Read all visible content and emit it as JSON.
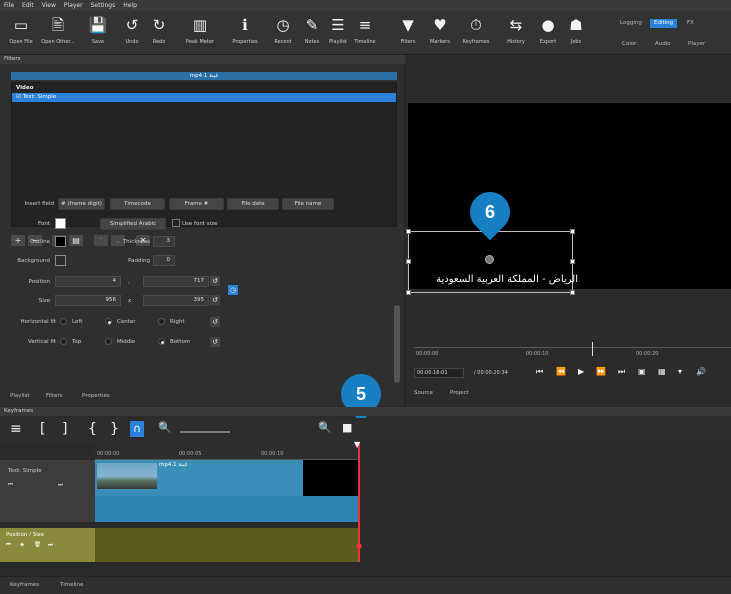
{
  "menu": [
    "File",
    "Edit",
    "View",
    "Player",
    "Settings",
    "Help"
  ],
  "toolbar": [
    {
      "icon": "folder-icon",
      "glyph": "▭",
      "label": "Open File"
    },
    {
      "icon": "open-other-icon",
      "glyph": "🖹",
      "label": "Open Other..."
    },
    {
      "icon": "save-icon",
      "glyph": "💾",
      "label": "Save"
    },
    {
      "icon": "undo-icon",
      "glyph": "↺",
      "label": "Undo"
    },
    {
      "icon": "redo-icon",
      "glyph": "↻",
      "label": "Redo"
    },
    {
      "icon": "peak-meter-icon",
      "glyph": "▥",
      "label": "Peak Meter"
    },
    {
      "icon": "properties-icon",
      "glyph": "ℹ",
      "label": "Properties"
    },
    {
      "icon": "recent-icon",
      "glyph": "◷",
      "label": "Recent"
    },
    {
      "icon": "notes-icon",
      "glyph": "✎",
      "label": "Notes"
    },
    {
      "icon": "playlist-icon",
      "glyph": "☰",
      "label": "Playlist"
    },
    {
      "icon": "timeline-icon",
      "glyph": "≡",
      "label": "Timeline"
    },
    {
      "icon": "filters-icon",
      "glyph": "▼",
      "label": "Filters"
    },
    {
      "icon": "markers-icon",
      "glyph": "♥",
      "label": "Markers"
    },
    {
      "icon": "keyframes-icon",
      "glyph": "⏱",
      "label": "Keyframes"
    },
    {
      "icon": "history-icon",
      "glyph": "⇆",
      "label": "History"
    },
    {
      "icon": "export-icon",
      "glyph": "●",
      "label": "Export"
    },
    {
      "icon": "jobs-icon",
      "glyph": "☗",
      "label": "Jobs"
    }
  ],
  "layouts": {
    "tabs": [
      "Logging",
      "Editing",
      "FX"
    ],
    "active": "Editing",
    "sub": [
      "Color",
      "Audio",
      "Player"
    ]
  },
  "filters": {
    "panel_title": "Filters",
    "clip_name": "mp4.1 غينة",
    "list_header": "Video",
    "filter_item": "Text: Simple",
    "insert_field_label": "Insert field",
    "insert_buttons": [
      "# (frame digit)",
      "Timecode",
      "Frame #",
      "File date",
      "File name"
    ],
    "font_label": "Font",
    "font_button": "Simplified Arabic",
    "use_font_size": "Use font size",
    "outline_label": "Outline",
    "thickness_label": "Thickness",
    "thickness_value": "3",
    "background_label": "Background",
    "padding_label": "Padding",
    "padding_value": "0",
    "position_label": "Position",
    "position_x": "4",
    "position_sep": ",",
    "position_y": "717",
    "size_label": "Size",
    "size_w": "956",
    "size_sep": "x",
    "size_h": "395",
    "hfit_label": "Horizontal fit",
    "hfit_options": [
      "Left",
      "Center",
      "Right"
    ],
    "vfit_label": "Vertical fit",
    "vfit_options": [
      "Top",
      "Middle",
      "Bottom"
    ],
    "bottom_tabs": [
      "Playlist",
      "Filters",
      "Properties"
    ]
  },
  "viewer": {
    "overlay_text": "الرياض - المملكة العربية السعودية",
    "ruler_ticks": [
      "00:00:00",
      "00:00:10",
      "00:00:20"
    ],
    "current_time": "00:00:16:01",
    "total_time": "/ 00:00:20:34",
    "tabs": [
      "Source",
      "Project"
    ]
  },
  "callouts": {
    "six": "6",
    "five": "5"
  },
  "keyframes": {
    "panel_title": "Keyframes",
    "ruler_ticks": [
      "00:00:00",
      "00:00:05",
      "00:00:10"
    ],
    "track1_name": "Text: Simple",
    "clip_label": "mp4.1 غينة",
    "track2_name": "Position / Size",
    "footer_tabs": [
      "Keyframes",
      "Timeline"
    ]
  },
  "colors": {
    "accent": "#2a82da",
    "callout": "#1780c4",
    "playhead": "#e33333"
  }
}
